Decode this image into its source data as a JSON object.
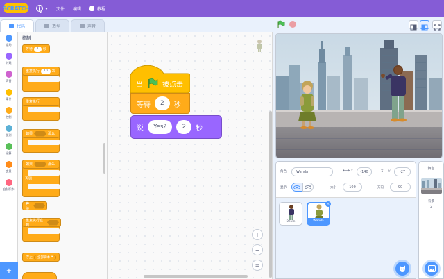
{
  "menu": {
    "logo_text": "SCRATCH",
    "file": "文件",
    "edit": "编辑",
    "tutorials": "教程"
  },
  "tabs": [
    {
      "label": "代码",
      "active": true
    },
    {
      "label": "造型",
      "active": false
    },
    {
      "label": "声音",
      "active": false
    }
  ],
  "categories": [
    {
      "label": "运动",
      "color": "#4c97ff"
    },
    {
      "label": "外观",
      "color": "#9966ff"
    },
    {
      "label": "声音",
      "color": "#cf63cf"
    },
    {
      "label": "事件",
      "color": "#ffbf00"
    },
    {
      "label": "控制",
      "color": "#ffab19"
    },
    {
      "label": "侦测",
      "color": "#5cb1d6"
    },
    {
      "label": "运算",
      "color": "#59c059"
    },
    {
      "label": "变量",
      "color": "#ff8c1a"
    },
    {
      "label": "自制积木",
      "color": "#ff6680"
    }
  ],
  "palette": {
    "section_title": "控制",
    "wait_label": "等待",
    "wait_value": "1",
    "wait_unit": "秒",
    "repeat_label": "重复执行",
    "repeat_value": "10",
    "repeat_unit": "次",
    "forever_label": "重复执行",
    "if_label": "如果",
    "then_label": "那么",
    "else_label": "否则",
    "wait_until_label": "等待",
    "repeat_until_label": "重复执行直到",
    "stop_label": "停止",
    "stop_value": "全部脚本"
  },
  "script": {
    "hat_prefix": "当",
    "hat_suffix": "被点击",
    "wait_label": "等待",
    "wait_value": "2",
    "wait_unit": "秒",
    "say_label": "说",
    "say_text": "Yes?",
    "say_value": "2",
    "say_unit": "秒"
  },
  "zoom": {
    "in": "+",
    "out": "−",
    "reset": "="
  },
  "sprite_info": {
    "sprite_label": "角色",
    "sprite_name": "Wanda",
    "x_label": "x",
    "x_value": "-140",
    "y_label": "y",
    "y_value": "-27",
    "show_label": "显示",
    "size_label": "大小",
    "size_value": "100",
    "direction_label": "方向",
    "direction_value": "90"
  },
  "sprites": [
    {
      "name": "Devin",
      "selected": false
    },
    {
      "name": "Wanda",
      "selected": true
    }
  ],
  "stage_pane": {
    "title": "舞台",
    "backdrop_label": "背景",
    "backdrop_count": "2"
  },
  "colors": {
    "menu": "#855cd6",
    "accent": "#4d97ff",
    "control": "#ffab19",
    "events": "#ffbf00",
    "looks": "#9966ff"
  }
}
